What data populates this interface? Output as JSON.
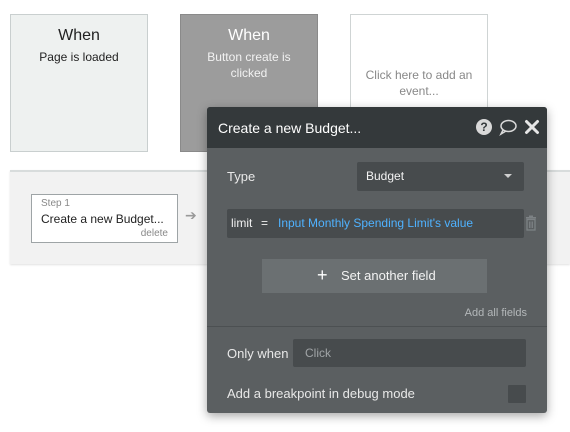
{
  "events": [
    {
      "when": "When",
      "description": "Page is loaded"
    },
    {
      "when": "When",
      "description": "Button create is clicked"
    },
    {
      "description": "Click here to add an event..."
    }
  ],
  "workflow": {
    "step": {
      "number_label": "Step 1",
      "name": "Create a new Budget...",
      "delete_label": "delete"
    }
  },
  "panel": {
    "title": "Create a new Budget...",
    "type_label": "Type",
    "type_value": "Budget",
    "field": {
      "key": "limit",
      "operator": "=",
      "expression": "Input Monthly Spending Limit's value"
    },
    "set_another_field_label": "Set another field",
    "add_all_fields_label": "Add all fields",
    "only_when_label": "Only when",
    "only_when_placeholder": "Click",
    "breakpoint_label": "Add a breakpoint in debug mode",
    "icons": [
      "help-icon",
      "comment-icon",
      "close-icon",
      "trash-icon",
      "plus-icon"
    ]
  },
  "colors": {
    "panel_bg": "#5b5f61",
    "panel_header": "#34393b",
    "expression": "#4fb2ff",
    "selected_event": "#9c9c9c"
  }
}
